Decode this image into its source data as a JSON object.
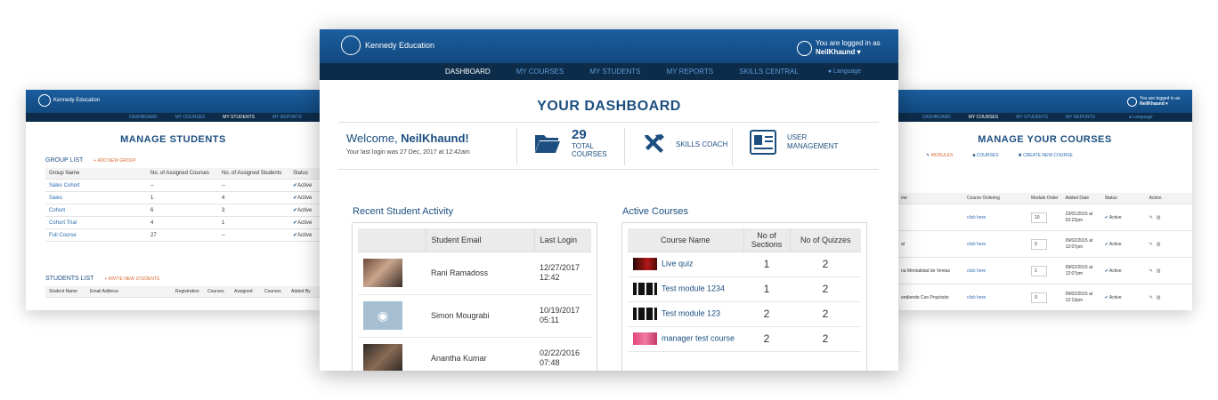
{
  "brand": "Kennedy Education",
  "left": {
    "nav": [
      "DASHBOARD",
      "MY COURSES",
      "MY STUDENTS",
      "MY REPORTS"
    ],
    "title": "MANAGE STUDENTS",
    "group_list": "GROUP LIST",
    "add_group": "+ ADD NEW GROUP",
    "group_headers": [
      "Group Name",
      "No. of Assigned Courses",
      "No. of Assigned Students",
      "Status"
    ],
    "groups": [
      [
        "Sales Cohort",
        "--",
        "--",
        "Active"
      ],
      [
        "Sales",
        "1",
        "4",
        "Active"
      ],
      [
        "Cohort",
        "6",
        "3",
        "Active"
      ],
      [
        "Cohort Trial",
        "4",
        "1",
        "Active"
      ],
      [
        "Full Course",
        "27",
        "--",
        "Active"
      ]
    ],
    "students_list": "STUDENTS LIST",
    "invite": "+ INVITE NEW STUDENTS",
    "student_headers": [
      "Student Name",
      "Email Address",
      "Registration",
      "Courses",
      "Assigned",
      "Courses",
      "Added By"
    ]
  },
  "main": {
    "logged_in": "You are logged in as",
    "user": "NeilKhaund ▾",
    "nav": [
      "DASHBOARD",
      "MY COURSES",
      "MY STUDENTS",
      "MY REPORTS",
      "SKILLS CENTRAL"
    ],
    "language": "Language",
    "title": "YOUR DASHBOARD",
    "welcome": "Welcome, ",
    "welcome_name": "NeilKhaund!",
    "last_login": "Your last login was 27 Dec, 2017 at 12:42am",
    "total_count": "29",
    "total_label1": "TOTAL",
    "total_label2": "COURSES",
    "skills": "SKILLS COACH",
    "user_mgmt1": "USER",
    "user_mgmt2": "MANAGEMENT",
    "recent_title": "Recent Student Activity",
    "recent_headers": [
      "",
      "Student Email",
      "Last Login"
    ],
    "recent": [
      {
        "name": "Rani Ramadoss",
        "d": "12/27/2017",
        "t": "12:42"
      },
      {
        "name": "Simon Mougrabi",
        "d": "10/19/2017",
        "t": "05:11"
      },
      {
        "name": "Anantha Kumar",
        "d": "02/22/2016",
        "t": "07:48"
      }
    ],
    "active_title": "Active Courses",
    "active_headers": [
      "Course Name",
      "No of",
      "Sections",
      "No of Quizzes"
    ],
    "courses": [
      {
        "name": "Live quiz",
        "sections": "1",
        "quizzes": "2"
      },
      {
        "name": "Test module 1234",
        "sections": "1",
        "quizzes": "2"
      },
      {
        "name": "Test module 123",
        "sections": "2",
        "quizzes": "2"
      },
      {
        "name": "manager test course",
        "sections": "2",
        "quizzes": "2"
      }
    ]
  },
  "right": {
    "logged_in": "You are logged in as",
    "user": "NeilKhaund ▾",
    "nav": [
      "DASHBOARD",
      "MY COURSES",
      "MY STUDENTS",
      "MY REPORTS"
    ],
    "language": "Language",
    "title": "MANAGE YOUR COURSES",
    "tabs": [
      "MODULES",
      "COURSES",
      "CREATE NEW COURSE"
    ],
    "headers": [
      "me",
      "Course Ordering",
      "Module Order",
      "Added Date",
      "Status",
      "Action"
    ],
    "rows": [
      {
        "name": "",
        "order": "10",
        "date": "23/01/2015 at",
        "time": "02:22pm"
      },
      {
        "name": "al",
        "order": "0",
        "date": "09/02/2015 at",
        "time": "12:07pm"
      },
      {
        "name": "na Mentalidad de Ventas",
        "order": "1",
        "date": "09/02/2015 at",
        "time": "12:07pm"
      },
      {
        "name": "endiendo Con Propósito",
        "order": "0",
        "date": "09/02/2015 at",
        "time": "12:13pm"
      }
    ],
    "click": "click here",
    "active": "Active"
  }
}
